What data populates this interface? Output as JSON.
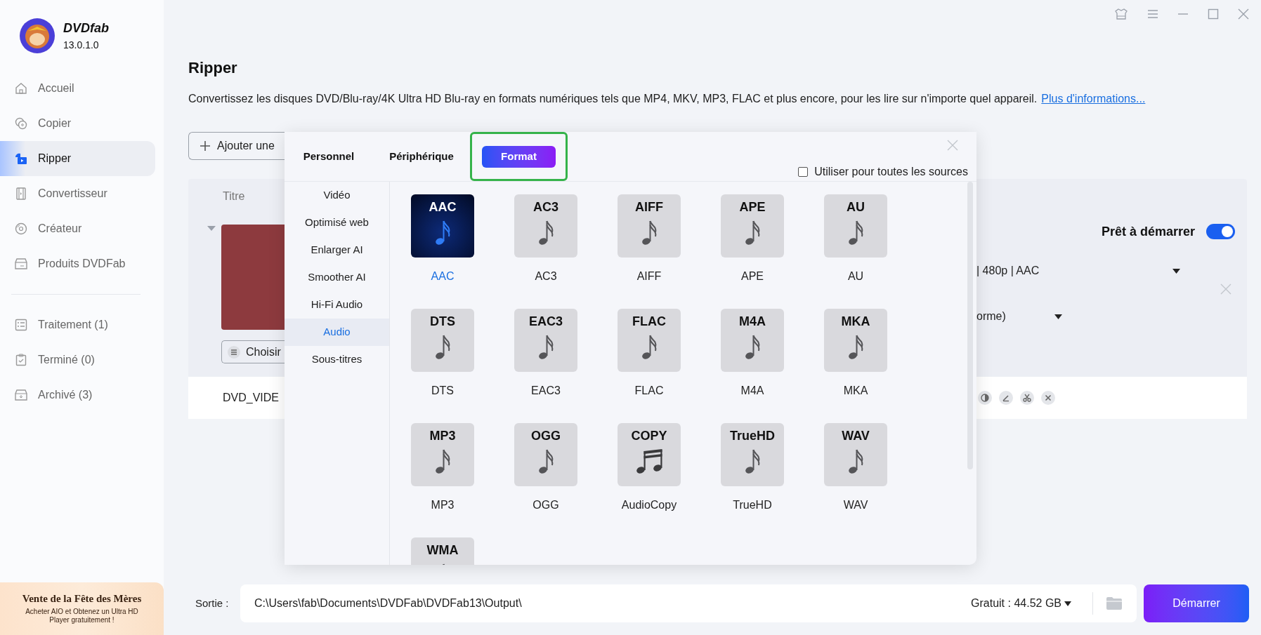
{
  "sidebar": {
    "app_name": "DVDfab",
    "version": "13.0.1.0",
    "items": [
      {
        "label": "Accueil",
        "selected": false,
        "kind": "home"
      },
      {
        "label": "Copier",
        "selected": false,
        "kind": "copy"
      },
      {
        "label": "Ripper",
        "selected": true,
        "kind": "rip"
      },
      {
        "label": "Convertisseur",
        "selected": false,
        "kind": "film"
      },
      {
        "label": "Créateur",
        "selected": false,
        "kind": "disc"
      },
      {
        "label": "Produits DVDFab",
        "selected": false,
        "kind": "box"
      }
    ],
    "queue_items": [
      {
        "label": "Traitement (1)",
        "kind": "list"
      },
      {
        "label": "Terminé (0)",
        "kind": "clipboard"
      },
      {
        "label": "Archivé (3)",
        "kind": "archive"
      }
    ],
    "promo": {
      "title": "Vente de la Fête des Mères",
      "text": "Acheter AIO et Obtenez un Ultra HD Player gratuitement !"
    }
  },
  "page": {
    "title": "Ripper",
    "description": "Convertissez les disques DVD/Blu-ray/4K Ultra HD Blu-ray en formats numériques tels que MP4, MKV, MP3, FLAC et plus encore, pour les lire sur n'importe quel appareil.",
    "link": "Plus d'informations..."
  },
  "toolbar": {
    "add_button": "Ajouter une"
  },
  "task_list": {
    "column_title": "Titre",
    "ready_label": "Prêt à démarrer",
    "ready_on": true,
    "profile": "| 480p | AAC",
    "audio_track": "orme)",
    "choose_button": "Choisir",
    "title_name": "DVD_VIDE"
  },
  "profile_dialog": {
    "tabs": [
      {
        "label": "Personnel",
        "selected": false
      },
      {
        "label": "Périphérique",
        "selected": false
      },
      {
        "label": "Format",
        "selected": true
      }
    ],
    "apply_all": {
      "label": "Utiliser pour toutes les sources",
      "checked": false
    },
    "categories": [
      {
        "label": "Vidéo",
        "selected": false
      },
      {
        "label": "Optimisé web",
        "selected": false
      },
      {
        "label": "Enlarger AI",
        "selected": false
      },
      {
        "label": "Smoother AI",
        "selected": false
      },
      {
        "label": "Hi-Fi Audio",
        "selected": false
      },
      {
        "label": "Audio",
        "selected": true
      },
      {
        "label": "Sous-titres",
        "selected": false
      }
    ],
    "formats": [
      {
        "tile_text": "AAC",
        "label": "AAC",
        "selected": true,
        "kind": "note"
      },
      {
        "tile_text": "AC3",
        "label": "AC3",
        "selected": false,
        "kind": "note"
      },
      {
        "tile_text": "AIFF",
        "label": "AIFF",
        "selected": false,
        "kind": "note"
      },
      {
        "tile_text": "APE",
        "label": "APE",
        "selected": false,
        "kind": "note"
      },
      {
        "tile_text": "AU",
        "label": "AU",
        "selected": false,
        "kind": "note"
      },
      {
        "tile_text": "DTS",
        "label": "DTS",
        "selected": false,
        "kind": "note"
      },
      {
        "tile_text": "EAC3",
        "label": "EAC3",
        "selected": false,
        "kind": "note"
      },
      {
        "tile_text": "FLAC",
        "label": "FLAC",
        "selected": false,
        "kind": "note"
      },
      {
        "tile_text": "M4A",
        "label": "M4A",
        "selected": false,
        "kind": "note"
      },
      {
        "tile_text": "MKA",
        "label": "MKA",
        "selected": false,
        "kind": "note"
      },
      {
        "tile_text": "MP3",
        "label": "MP3",
        "selected": false,
        "kind": "note"
      },
      {
        "tile_text": "OGG",
        "label": "OGG",
        "selected": false,
        "kind": "note"
      },
      {
        "tile_text": "COPY",
        "label": "AudioCopy",
        "selected": false,
        "kind": "beamed"
      },
      {
        "tile_text": "TrueHD",
        "label": "TrueHD",
        "selected": false,
        "kind": "note"
      },
      {
        "tile_text": "WAV",
        "label": "WAV",
        "selected": false,
        "kind": "note"
      },
      {
        "tile_text": "WMA",
        "selected": false,
        "kind": "note"
      }
    ]
  },
  "output_bar": {
    "label": "Sortie :",
    "path": "C:\\Users\\fab\\Documents\\DVDFab\\DVDFab13\\Output\\",
    "free_space": "Gratuit : 44.52 GB",
    "start_button": "Démarrer"
  }
}
